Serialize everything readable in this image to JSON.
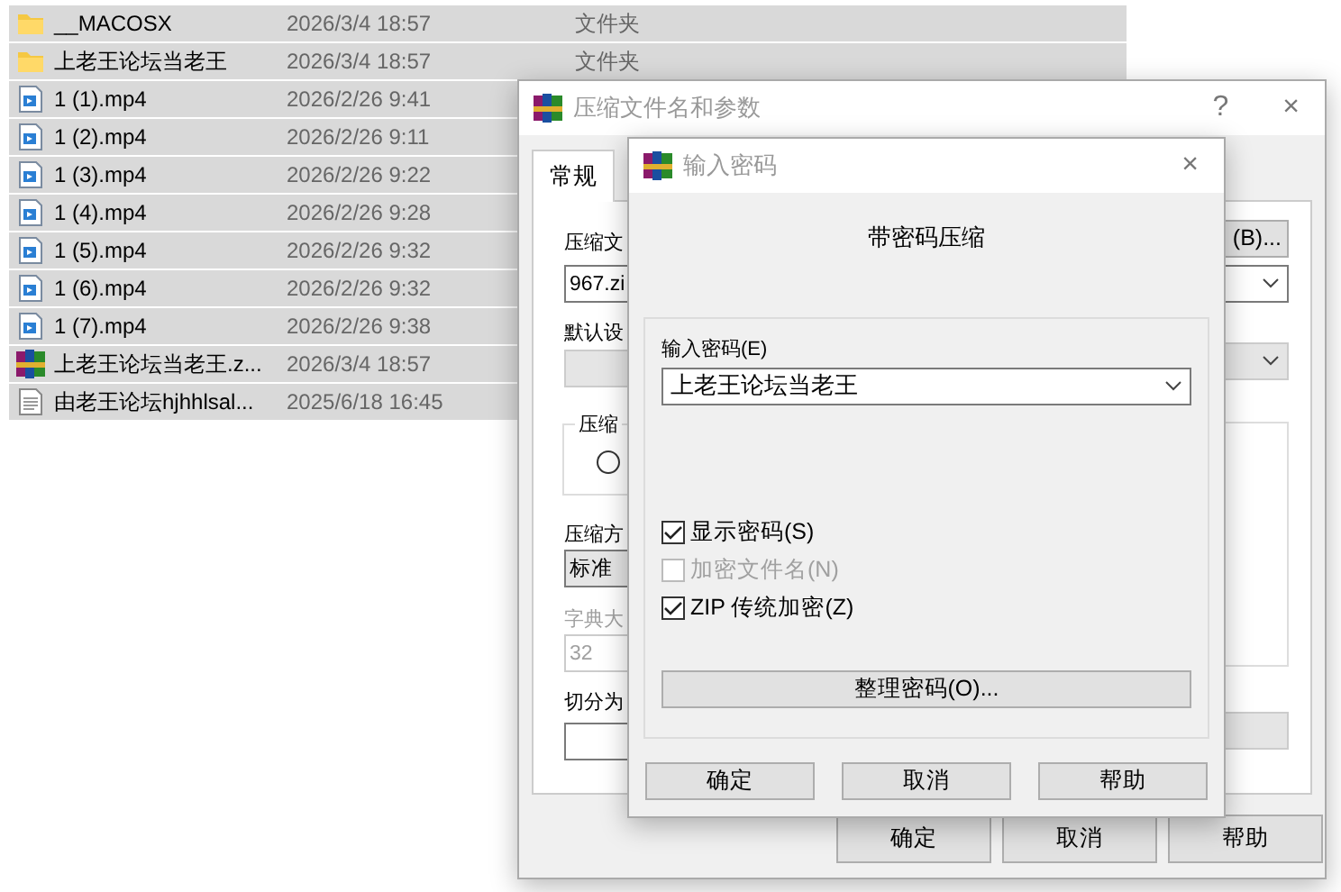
{
  "files": [
    {
      "name": "__MACOSX",
      "modified": "2026/3/4 18:57",
      "type": "文件夹",
      "kind": "folder",
      "selected": true
    },
    {
      "name": "上老王论坛当老王",
      "modified": "2026/3/4 18:57",
      "type": "文件夹",
      "kind": "folder",
      "selected": true
    },
    {
      "name": "1 (1).mp4",
      "modified": "2026/2/26 9:41",
      "kind": "video",
      "selected": true
    },
    {
      "name": "1 (2).mp4",
      "modified": "2026/2/26 9:11",
      "kind": "video",
      "selected": true
    },
    {
      "name": "1 (3).mp4",
      "modified": "2026/2/26 9:22",
      "kind": "video",
      "selected": true
    },
    {
      "name": "1 (4).mp4",
      "modified": "2026/2/26 9:28",
      "kind": "video",
      "selected": true
    },
    {
      "name": "1 (5).mp4",
      "modified": "2026/2/26 9:32",
      "kind": "video",
      "selected": true
    },
    {
      "name": "1 (6).mp4",
      "modified": "2026/2/26 9:32",
      "kind": "video",
      "selected": true
    },
    {
      "name": "1 (7).mp4",
      "modified": "2026/2/26 9:38",
      "kind": "video",
      "selected": true
    },
    {
      "name": "上老王论坛当老王.z...",
      "modified": "2026/3/4 18:57",
      "kind": "archive",
      "selected": true
    },
    {
      "name": "由老王论坛hjhhlsal...",
      "modified": "2025/6/18 16:45",
      "kind": "text",
      "selected": true
    }
  ],
  "back_dialog": {
    "title": "压缩文件名和参数",
    "help_button": "?",
    "close_button": "×",
    "tabs": [
      {
        "label": "常规",
        "selected": true
      }
    ],
    "archive_name_label": "压缩文",
    "archive_name": "967.zi",
    "browse_button": "(B)...",
    "profile_label": "默认设",
    "format_group_label": "压缩",
    "format_option": {
      "selected": false
    },
    "method_label": "压缩方",
    "method": "标准",
    "dictionary": {
      "label": "字典大",
      "value": "32",
      "disabled": true
    },
    "split_label": "切分为",
    "buttons": [
      "确定",
      "取消",
      "帮助"
    ]
  },
  "front_dialog": {
    "title": "输入密码",
    "close_button": "×",
    "heading": "带密码压缩",
    "password_label": "输入密码(E)",
    "password": "上老王论坛当老王",
    "options": [
      {
        "label": "显示密码(S)",
        "checked": true,
        "disabled": false
      },
      {
        "label": "加密文件名(N)",
        "checked": false,
        "disabled": true
      },
      {
        "label": "ZIP 传统加密(Z)",
        "checked": true,
        "disabled": false
      }
    ],
    "organize_button": "整理密码(O)...",
    "buttons": [
      "确定",
      "取消",
      "帮助"
    ]
  }
}
